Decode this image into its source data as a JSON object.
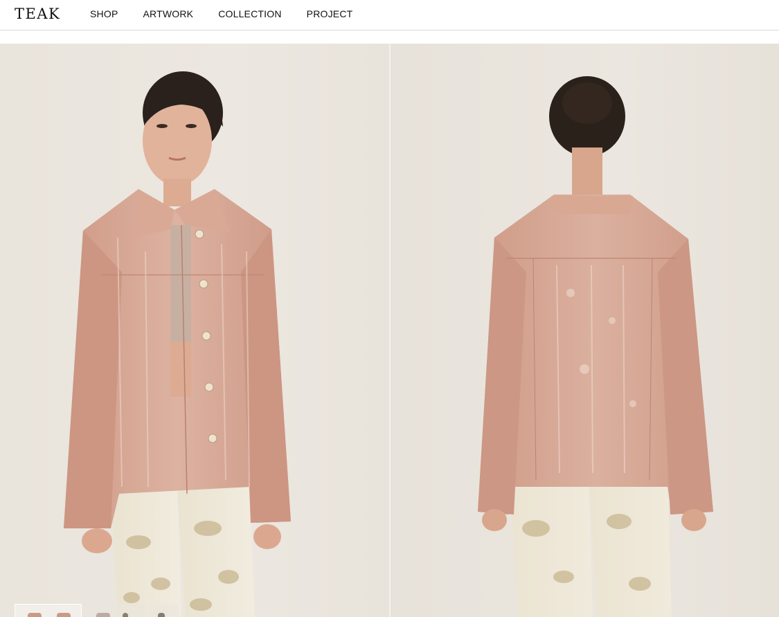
{
  "brand": {
    "logo_text": "TEAK"
  },
  "nav": {
    "items": [
      {
        "label": "SHOP"
      },
      {
        "label": "ARTWORK"
      },
      {
        "label": "COLLECTION"
      },
      {
        "label": "PROJECT"
      }
    ]
  },
  "gallery": {
    "images": [
      {
        "view": "front"
      },
      {
        "view": "back"
      }
    ],
    "thumbnails_count": 3,
    "active_thumbnail": 1
  },
  "colors": {
    "header_bg": "#ffffff",
    "text": "#111111",
    "backdrop": "#ebe6df",
    "jacket": "#d7a390",
    "pants": "#ece6d6"
  }
}
